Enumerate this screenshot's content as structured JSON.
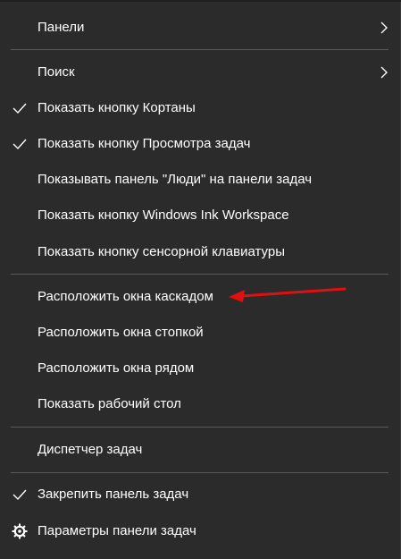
{
  "menu": {
    "items": {
      "panels": {
        "label": "Панели",
        "has_submenu": true
      },
      "search": {
        "label": "Поиск",
        "has_submenu": true
      },
      "show_cortana": {
        "label": "Показать кнопку Кортаны",
        "checked": true
      },
      "show_task_view": {
        "label": "Показать кнопку Просмотра задач",
        "checked": true
      },
      "show_people": {
        "label": "Показывать панель \"Люди\" на панели задач",
        "checked": false
      },
      "show_ink": {
        "label": "Показать кнопку Windows Ink Workspace",
        "checked": false
      },
      "show_keyboard": {
        "label": "Показать кнопку сенсорной клавиатуры",
        "checked": false
      },
      "cascade": {
        "label": "Расположить окна каскадом"
      },
      "stack": {
        "label": "Расположить окна стопкой"
      },
      "side_by_side": {
        "label": "Расположить окна рядом"
      },
      "show_desktop": {
        "label": "Показать рабочий стол"
      },
      "task_manager": {
        "label": "Диспетчер задач"
      },
      "lock_taskbar": {
        "label": "Закрепить панель задач",
        "checked": true
      },
      "taskbar_settings": {
        "label": "Параметры панели задач",
        "icon": "gear-icon"
      }
    }
  },
  "colors": {
    "background": "#2b2b2b",
    "text": "#ffffff",
    "separator": "#5a5a5a",
    "annotation_arrow": "#e01010"
  },
  "annotation": {
    "type": "arrow",
    "points_to": "cascade"
  }
}
